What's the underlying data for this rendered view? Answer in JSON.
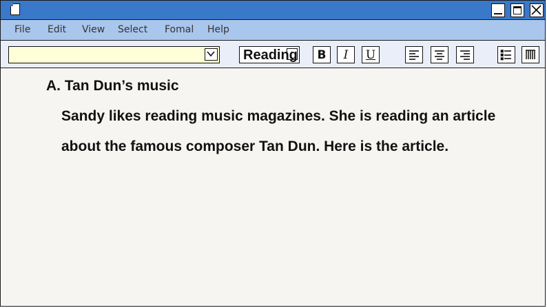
{
  "window": {
    "icons": {
      "doc": "document-icon",
      "minimize": "minimize-icon",
      "maximize": "maximize-icon",
      "close": "close-icon"
    }
  },
  "menu": {
    "items": [
      {
        "label": "File"
      },
      {
        "label": "Edit"
      },
      {
        "label": "View"
      },
      {
        "label": "Select"
      },
      {
        "label": "Fomal"
      },
      {
        "label": "Help"
      }
    ]
  },
  "toolbar": {
    "font_value": "",
    "size_label": "Reading",
    "bold_label": "B",
    "italic_label": "I",
    "underline_label": "U",
    "icons": [
      "chevron-down-icon",
      "align-left-icon",
      "align-center-icon",
      "align-right-icon",
      "bullet-list-icon",
      "columns-icon"
    ]
  },
  "document": {
    "heading": "A. Tan Dun’s music",
    "lines": [
      "Sandy likes reading music magazines. She is reading an article",
      "about the famous composer Tan Dun. Here is the article."
    ]
  },
  "colors": {
    "titlebar": "#3a78c9",
    "menubar": "#a9c6ec",
    "font_field": "#fefed8",
    "page": "#f6f5f2"
  }
}
